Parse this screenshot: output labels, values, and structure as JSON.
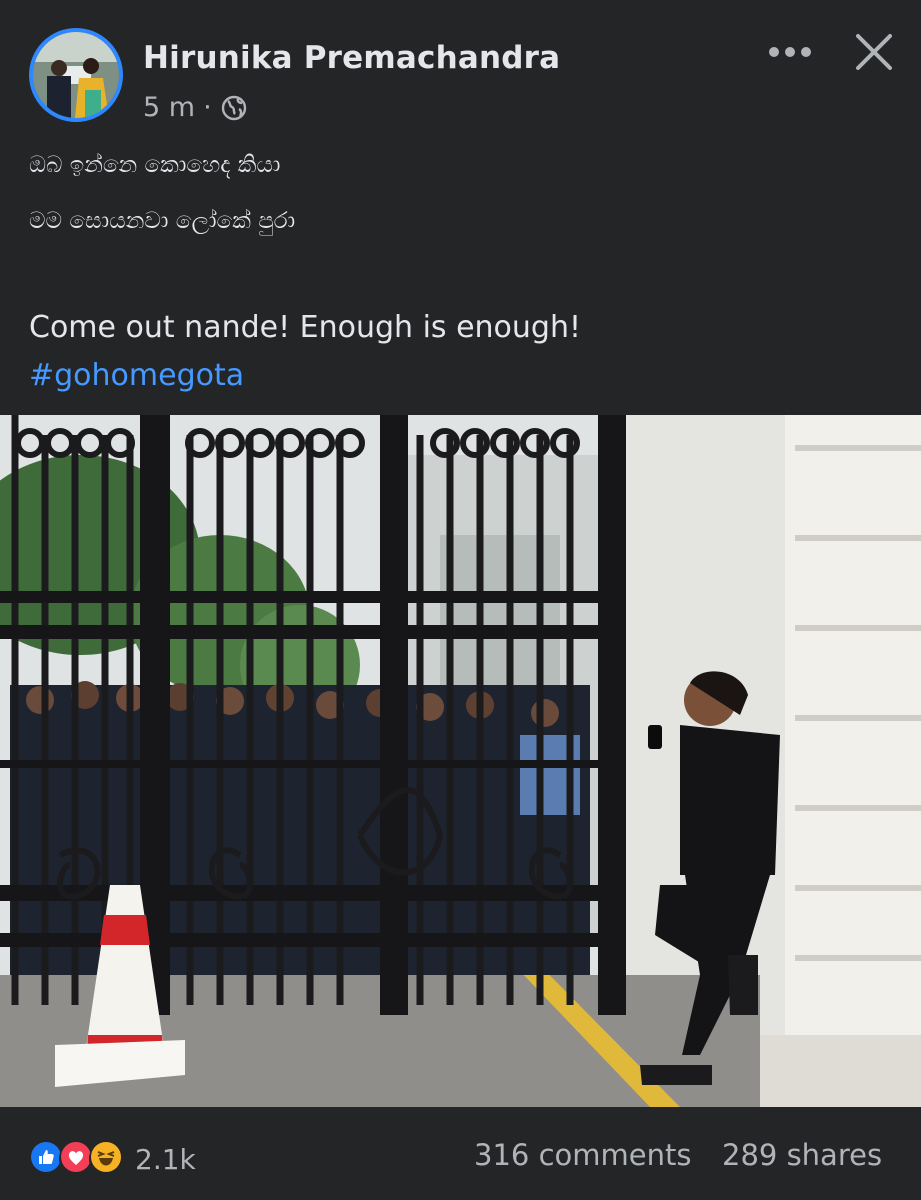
{
  "post": {
    "author": "Hirunika Premachandra",
    "time": "5 m",
    "separator": "·",
    "privacy_icon": "globe-icon",
    "lines": [
      "ඔබ ඉන්නෙ කොහෙද කියා",
      "මම සොයනවා ලෝකේ පුරා",
      "Come out nande! Enough is enough!"
    ],
    "hashtag": "#gohomegota"
  },
  "header": {
    "more_icon": "more-options-icon",
    "close_icon": "close-icon"
  },
  "footer": {
    "reactions": [
      "like",
      "love",
      "haha"
    ],
    "reaction_count": "2.1k",
    "comments": "316 comments",
    "shares": "289 shares"
  },
  "colors": {
    "background": "#242526",
    "text_primary": "#e4e6eb",
    "text_secondary": "#b0b3b8",
    "link": "#4599ff",
    "like": "#1877f2",
    "love": "#f33e58",
    "haha": "#f7b125"
  }
}
